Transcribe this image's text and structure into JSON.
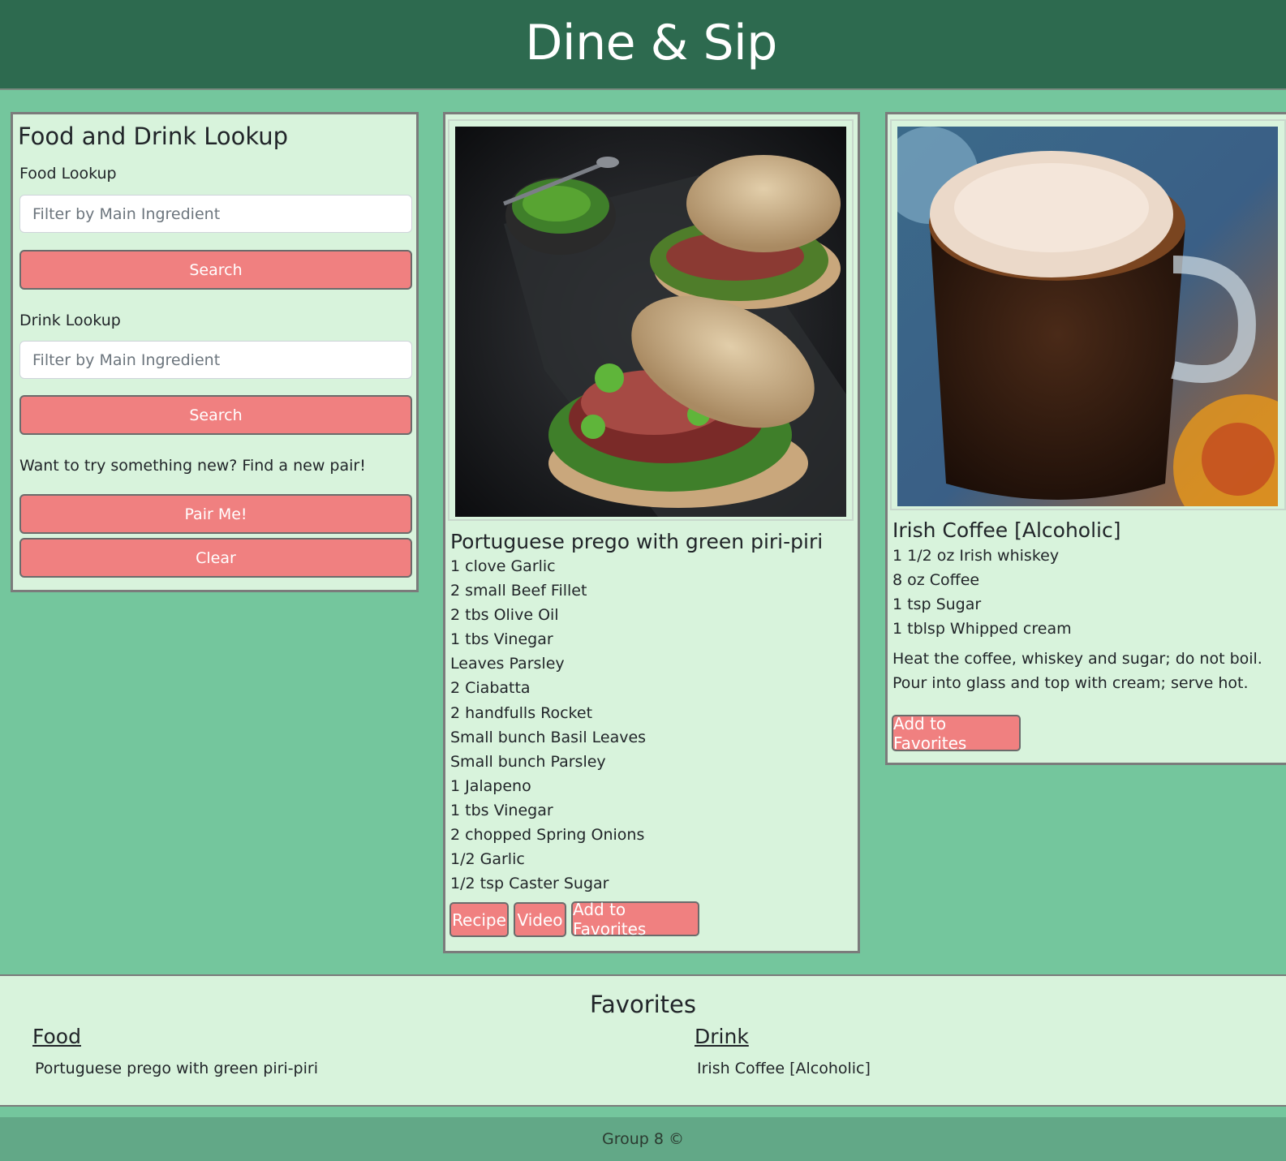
{
  "header": {
    "title": "Dine & Sip"
  },
  "lookup": {
    "title": "Food and Drink Lookup",
    "food_label": "Food Lookup",
    "food_placeholder": "Filter by Main Ingredient",
    "food_search": "Search",
    "drink_label": "Drink Lookup",
    "drink_placeholder": "Filter by Main Ingredient",
    "drink_search": "Search",
    "prompt": "Want to try something new? Find a new pair!",
    "pair_button": "Pair Me!",
    "clear_button": "Clear"
  },
  "food": {
    "title": "Portuguese prego with green piri-piri",
    "ingredients": [
      "1 clove Garlic",
      "2 small Beef Fillet",
      "2 tbs Olive Oil",
      "1 tbs Vinegar",
      "Leaves Parsley",
      "2 Ciabatta",
      "2 handfulls Rocket",
      "Small bunch Basil Leaves",
      "Small bunch Parsley",
      "1 Jalapeno",
      "1 tbs Vinegar",
      "2 chopped Spring Onions",
      "1/2 Garlic",
      "1/2 tsp Caster Sugar"
    ],
    "recipe_button": "Recipe",
    "video_button": "Video",
    "favorite_button": "Add to Favorites"
  },
  "drink": {
    "title": "Irish Coffee [Alcoholic]",
    "ingredients": [
      "1 1/2 oz Irish whiskey",
      "8 oz Coffee",
      "1 tsp Sugar",
      "1 tblsp Whipped cream"
    ],
    "instructions": "Heat the coffee, whiskey and sugar; do not boil. Pour into glass and top with cream; serve hot.",
    "favorite_button": "Add to Favorites"
  },
  "favorites": {
    "title": "Favorites",
    "food_heading": "Food",
    "drink_heading": "Drink",
    "food_items": [
      "Portuguese prego with green piri-piri"
    ],
    "drink_items": [
      "Irish Coffee [Alcoholic]"
    ]
  },
  "footer": {
    "text": "Group 8 ©"
  },
  "colors": {
    "header_bg": "#2d6a4f",
    "page_bg": "#74c69d",
    "panel_bg": "#d8f3dc",
    "button": "#f08080",
    "footer_bg": "#62a887"
  }
}
